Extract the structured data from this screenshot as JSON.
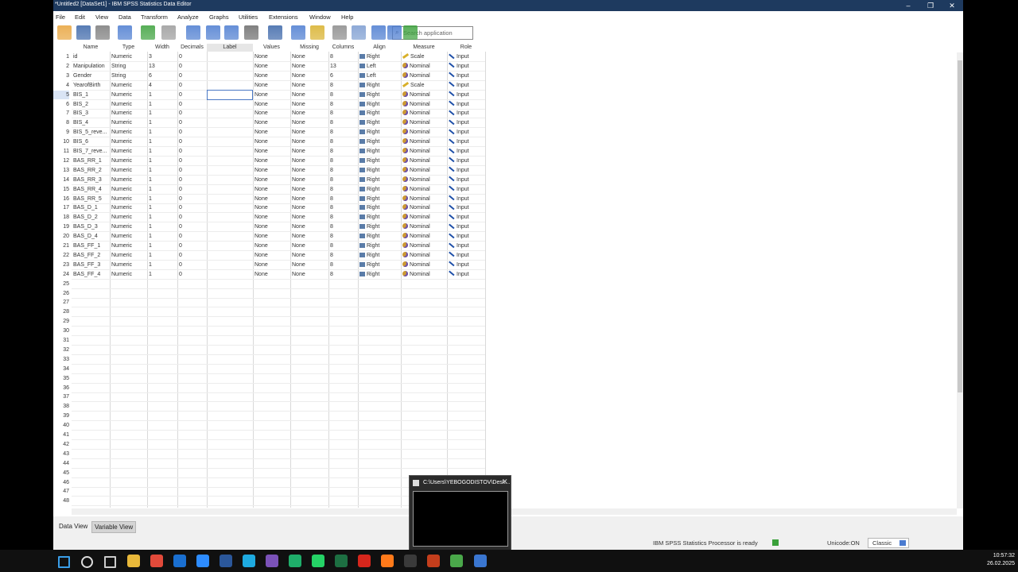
{
  "window": {
    "title": "*Untitled2 [DataSet1] - IBM SPSS Statistics Data Editor"
  },
  "window_controls": {
    "minimize": "–",
    "restore": "❐",
    "close": "✕"
  },
  "menu": [
    "File",
    "Edit",
    "View",
    "Data",
    "Transform",
    "Analyze",
    "Graphs",
    "Utilities",
    "Extensions",
    "Window",
    "Help"
  ],
  "toolbar": {
    "icons": [
      "open-icon",
      "save-icon",
      "print-icon",
      "recall-dialog-icon",
      "undo-icon",
      "redo-icon",
      "goto-case-icon",
      "goto-variable-icon",
      "variables-icon",
      "run-descriptives-icon",
      "find-icon",
      "insert-cases-icon",
      "insert-variable-icon",
      "split-file-icon",
      "weight-cases-icon",
      "select-cases-icon",
      "value-labels-icon",
      "use-variable-sets-icon"
    ],
    "search_placeholder": "Search application"
  },
  "columns": [
    "Name",
    "Type",
    "Width",
    "Decimals",
    "Label",
    "Values",
    "Missing",
    "Columns",
    "Align",
    "Measure",
    "Role"
  ],
  "rows": [
    {
      "n": "1",
      "name": "id",
      "type": "Numeric",
      "width": "3",
      "dec": "0",
      "label": "",
      "values": "None",
      "missing": "None",
      "cols": "8",
      "align": "Right",
      "measure": "Scale",
      "role": "Input"
    },
    {
      "n": "2",
      "name": "Manipulation",
      "type": "String",
      "width": "13",
      "dec": "0",
      "label": "",
      "values": "None",
      "missing": "None",
      "cols": "13",
      "align": "Left",
      "measure": "Nominal",
      "role": "Input"
    },
    {
      "n": "3",
      "name": "Gender",
      "type": "String",
      "width": "6",
      "dec": "0",
      "label": "",
      "values": "None",
      "missing": "None",
      "cols": "6",
      "align": "Left",
      "measure": "Nominal",
      "role": "Input"
    },
    {
      "n": "4",
      "name": "YearofBirth",
      "type": "Numeric",
      "width": "4",
      "dec": "0",
      "label": "",
      "values": "None",
      "missing": "None",
      "cols": "8",
      "align": "Right",
      "measure": "Scale",
      "role": "Input"
    },
    {
      "n": "5",
      "name": "BIS_1",
      "type": "Numeric",
      "width": "1",
      "dec": "0",
      "label": "",
      "values": "None",
      "missing": "None",
      "cols": "8",
      "align": "Right",
      "measure": "Nominal",
      "role": "Input"
    },
    {
      "n": "6",
      "name": "BIS_2",
      "type": "Numeric",
      "width": "1",
      "dec": "0",
      "label": "",
      "values": "None",
      "missing": "None",
      "cols": "8",
      "align": "Right",
      "measure": "Nominal",
      "role": "Input"
    },
    {
      "n": "7",
      "name": "BIS_3",
      "type": "Numeric",
      "width": "1",
      "dec": "0",
      "label": "",
      "values": "None",
      "missing": "None",
      "cols": "8",
      "align": "Right",
      "measure": "Nominal",
      "role": "Input"
    },
    {
      "n": "8",
      "name": "BIS_4",
      "type": "Numeric",
      "width": "1",
      "dec": "0",
      "label": "",
      "values": "None",
      "missing": "None",
      "cols": "8",
      "align": "Right",
      "measure": "Nominal",
      "role": "Input"
    },
    {
      "n": "9",
      "name": "BIS_5_reve...",
      "type": "Numeric",
      "width": "1",
      "dec": "0",
      "label": "",
      "values": "None",
      "missing": "None",
      "cols": "8",
      "align": "Right",
      "measure": "Nominal",
      "role": "Input"
    },
    {
      "n": "10",
      "name": "BIS_6",
      "type": "Numeric",
      "width": "1",
      "dec": "0",
      "label": "",
      "values": "None",
      "missing": "None",
      "cols": "8",
      "align": "Right",
      "measure": "Nominal",
      "role": "Input"
    },
    {
      "n": "11",
      "name": "BIS_7_reve...",
      "type": "Numeric",
      "width": "1",
      "dec": "0",
      "label": "",
      "values": "None",
      "missing": "None",
      "cols": "8",
      "align": "Right",
      "measure": "Nominal",
      "role": "Input"
    },
    {
      "n": "12",
      "name": "BAS_RR_1",
      "type": "Numeric",
      "width": "1",
      "dec": "0",
      "label": "",
      "values": "None",
      "missing": "None",
      "cols": "8",
      "align": "Right",
      "measure": "Nominal",
      "role": "Input"
    },
    {
      "n": "13",
      "name": "BAS_RR_2",
      "type": "Numeric",
      "width": "1",
      "dec": "0",
      "label": "",
      "values": "None",
      "missing": "None",
      "cols": "8",
      "align": "Right",
      "measure": "Nominal",
      "role": "Input"
    },
    {
      "n": "14",
      "name": "BAS_RR_3",
      "type": "Numeric",
      "width": "1",
      "dec": "0",
      "label": "",
      "values": "None",
      "missing": "None",
      "cols": "8",
      "align": "Right",
      "measure": "Nominal",
      "role": "Input"
    },
    {
      "n": "15",
      "name": "BAS_RR_4",
      "type": "Numeric",
      "width": "1",
      "dec": "0",
      "label": "",
      "values": "None",
      "missing": "None",
      "cols": "8",
      "align": "Right",
      "measure": "Nominal",
      "role": "Input"
    },
    {
      "n": "16",
      "name": "BAS_RR_5",
      "type": "Numeric",
      "width": "1",
      "dec": "0",
      "label": "",
      "values": "None",
      "missing": "None",
      "cols": "8",
      "align": "Right",
      "measure": "Nominal",
      "role": "Input"
    },
    {
      "n": "17",
      "name": "BAS_D_1",
      "type": "Numeric",
      "width": "1",
      "dec": "0",
      "label": "",
      "values": "None",
      "missing": "None",
      "cols": "8",
      "align": "Right",
      "measure": "Nominal",
      "role": "Input"
    },
    {
      "n": "18",
      "name": "BAS_D_2",
      "type": "Numeric",
      "width": "1",
      "dec": "0",
      "label": "",
      "values": "None",
      "missing": "None",
      "cols": "8",
      "align": "Right",
      "measure": "Nominal",
      "role": "Input"
    },
    {
      "n": "19",
      "name": "BAS_D_3",
      "type": "Numeric",
      "width": "1",
      "dec": "0",
      "label": "",
      "values": "None",
      "missing": "None",
      "cols": "8",
      "align": "Right",
      "measure": "Nominal",
      "role": "Input"
    },
    {
      "n": "20",
      "name": "BAS_D_4",
      "type": "Numeric",
      "width": "1",
      "dec": "0",
      "label": "",
      "values": "None",
      "missing": "None",
      "cols": "8",
      "align": "Right",
      "measure": "Nominal",
      "role": "Input"
    },
    {
      "n": "21",
      "name": "BAS_FF_1",
      "type": "Numeric",
      "width": "1",
      "dec": "0",
      "label": "",
      "values": "None",
      "missing": "None",
      "cols": "8",
      "align": "Right",
      "measure": "Nominal",
      "role": "Input"
    },
    {
      "n": "22",
      "name": "BAS_FF_2",
      "type": "Numeric",
      "width": "1",
      "dec": "0",
      "label": "",
      "values": "None",
      "missing": "None",
      "cols": "8",
      "align": "Right",
      "measure": "Nominal",
      "role": "Input"
    },
    {
      "n": "23",
      "name": "BAS_FF_3",
      "type": "Numeric",
      "width": "1",
      "dec": "0",
      "label": "",
      "values": "None",
      "missing": "None",
      "cols": "8",
      "align": "Right",
      "measure": "Nominal",
      "role": "Input"
    },
    {
      "n": "24",
      "name": "BAS_FF_4",
      "type": "Numeric",
      "width": "1",
      "dec": "0",
      "label": "",
      "values": "None",
      "missing": "None",
      "cols": "8",
      "align": "Right",
      "measure": "Nominal",
      "role": "Input"
    }
  ],
  "empty_rows": [
    "25",
    "26",
    "27",
    "28",
    "29",
    "30",
    "31",
    "32",
    "33",
    "34",
    "35",
    "36",
    "37",
    "38",
    "39",
    "40",
    "41",
    "42",
    "43",
    "44",
    "45",
    "46",
    "47",
    "48"
  ],
  "selected_cell": {
    "row": "5",
    "column": "Label"
  },
  "tabs": [
    {
      "label": "Data View",
      "active": false
    },
    {
      "label": "Variable View",
      "active": true
    }
  ],
  "status": {
    "processor": "IBM SPSS Statistics Processor is ready",
    "unicode": "Unicode:ON",
    "classic": "Classic"
  },
  "preview": {
    "title": "C:\\Users\\YEBOGODISTOV\\Desk..."
  },
  "taskbar": {
    "apps": [
      "start-icon",
      "search-icon",
      "task-view-icon",
      "file-explorer-icon",
      "chrome-icon",
      "outlook-icon",
      "zoom-icon",
      "word-icon",
      "skype-icon",
      "viber-icon",
      "spreadsheet-app-icon",
      "whatsapp-icon",
      "excel-icon",
      "acrobat-icon",
      "firefox-icon",
      "pycharm-icon",
      "powerpoint-icon",
      "spss-data-editor-icon",
      "spss-icon"
    ],
    "time": "10:57:32",
    "date": "26.02.2025"
  }
}
